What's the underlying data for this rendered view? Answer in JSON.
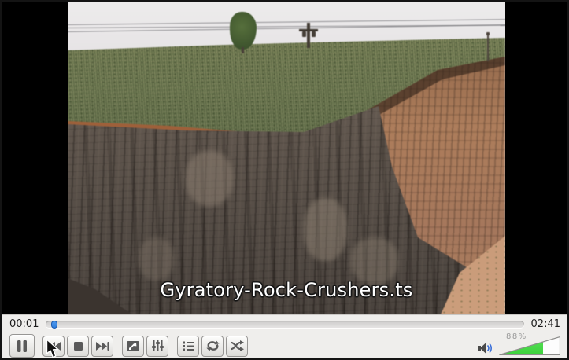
{
  "video": {
    "overlay_title": "Gyratory-Rock-Crushers.ts"
  },
  "transport": {
    "elapsed": "00:01",
    "duration": "02:41",
    "progress_percent": 1
  },
  "controls": {
    "buttons": [
      {
        "name": "pause",
        "icon": "pause-icon",
        "label": "Pause"
      },
      {
        "name": "previous",
        "icon": "skip-backward-icon",
        "label": "Previous"
      },
      {
        "name": "stop",
        "icon": "stop-icon",
        "label": "Stop"
      },
      {
        "name": "next",
        "icon": "skip-forward-icon",
        "label": "Next"
      },
      {
        "name": "fullscreen",
        "icon": "fullscreen-icon",
        "label": "Fullscreen"
      },
      {
        "name": "extended-settings",
        "icon": "equalizer-icon",
        "label": "Extended Settings"
      },
      {
        "name": "playlist",
        "icon": "playlist-icon",
        "label": "Playlist"
      },
      {
        "name": "repeat",
        "icon": "repeat-icon",
        "label": "Repeat"
      },
      {
        "name": "shuffle",
        "icon": "shuffle-icon",
        "label": "Shuffle"
      }
    ]
  },
  "volume": {
    "label": "88%",
    "fill_percent": 72,
    "icon": "speaker-icon"
  },
  "colors": {
    "accent_blue": "#2f7fe0",
    "volume_green": "#3bd23b",
    "panel_bg": "#efeeec",
    "window_border": "#141414",
    "letterbox": "#000000"
  }
}
